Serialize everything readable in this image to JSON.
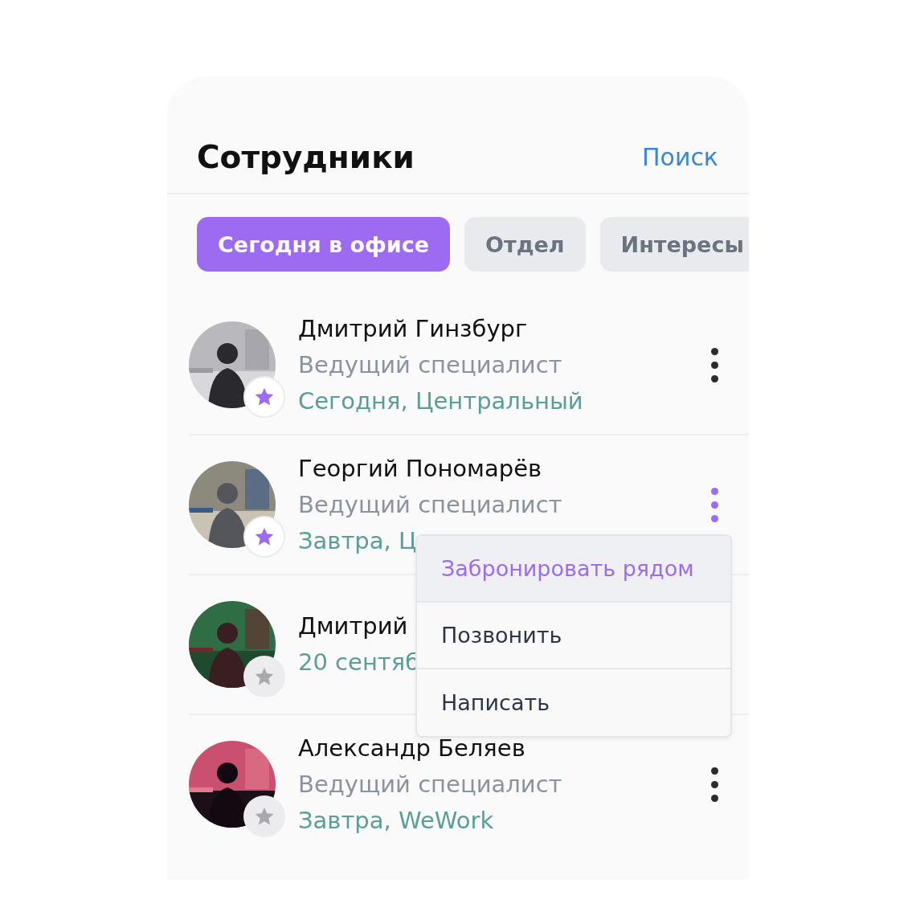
{
  "header": {
    "title": "Сотрудники",
    "search_link": "Поиск"
  },
  "filters": [
    {
      "label": "Сегодня в офисе",
      "selected": true
    },
    {
      "label": "Отдел",
      "selected": false
    },
    {
      "label": "Интересы",
      "selected": false
    }
  ],
  "employees": [
    {
      "name": "Дмитрий Гинзбург",
      "role": "Ведущий специалист",
      "location": "Сегодня, Центральный",
      "favorite": true,
      "menu_open": false,
      "menu_button": true
    },
    {
      "name": "Георгий Пономарёв",
      "role": "Ведущий специалист",
      "location": "Завтра, Ц",
      "favorite": true,
      "menu_open": true,
      "menu_button": true
    },
    {
      "name": "Дмитрий",
      "location": "20 сентяб",
      "favorite": false,
      "menu_open": false,
      "menu_button": false
    },
    {
      "name": "Александр Беляев",
      "role": "Ведущий специалист",
      "location": "Завтра, WeWork",
      "favorite": false,
      "menu_open": false,
      "menu_button": true
    }
  ],
  "context_menu": {
    "items": [
      {
        "label": "Забронировать рядом",
        "selected": true
      },
      {
        "label": "Позвонить",
        "selected": false
      },
      {
        "label": "Написать",
        "selected": false
      }
    ]
  }
}
